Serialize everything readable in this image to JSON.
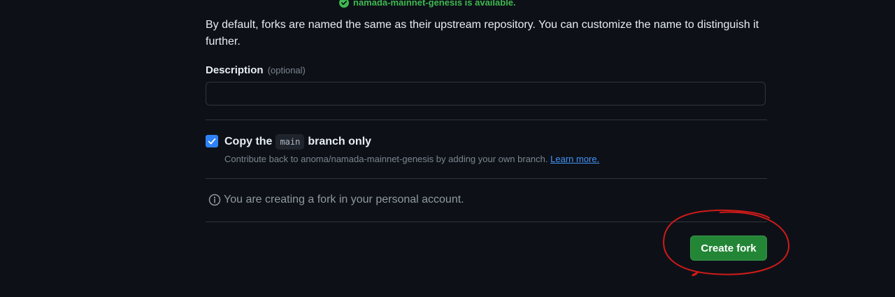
{
  "availability": {
    "message": "namada-mainnet-genesis is available.",
    "icon": "check-circle-icon",
    "color": "#3fb950"
  },
  "intro_text": "By default, forks are named the same as their upstream repository. You can customize the name to distinguish it further.",
  "description": {
    "label": "Description",
    "optional": "(optional)",
    "value": ""
  },
  "copy_branch": {
    "checked": true,
    "label_prefix": "Copy the",
    "branch": "main",
    "label_suffix": "branch only",
    "help_text": "Contribute back to anoma/namada-mainnet-genesis by adding your own branch.",
    "learn_more": "Learn more."
  },
  "info": {
    "icon": "info-icon",
    "text": "You are creating a fork in your personal account."
  },
  "create_button": {
    "label": "Create fork",
    "color": "#238636"
  },
  "colors": {
    "background": "#0d1117",
    "accent_blue": "#2f81f7",
    "annotation_red": "#d11a1a"
  }
}
